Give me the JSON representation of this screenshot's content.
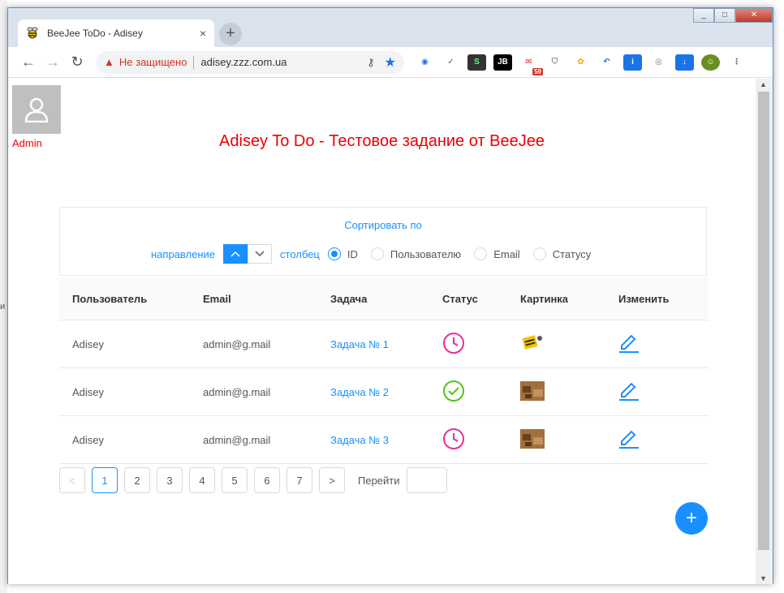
{
  "browser": {
    "tab_title": "BeeJee ToDo - Adisey",
    "tab_close": "×",
    "new_tab": "+",
    "insecure_label": "Не защищено",
    "url": "adisey.zzz.com.ua",
    "ext_badge": "59"
  },
  "page": {
    "user_label": "Admin",
    "title": "Adisey To Do - Тестовое задание от BeeJee"
  },
  "sort": {
    "title": "Сортировать по",
    "direction_label": "направление",
    "column_label": "столбец",
    "options": [
      "ID",
      "Пользователю",
      "Email",
      "Статусу"
    ],
    "selected": "ID"
  },
  "table": {
    "headers": [
      "Пользователь",
      "Email",
      "Задача",
      "Статус",
      "Картинка",
      "Изменить"
    ],
    "rows": [
      {
        "user": "Adisey",
        "email": "admin@g.mail",
        "task": "Задача № 1",
        "status": "pending"
      },
      {
        "user": "Adisey",
        "email": "admin@g.mail",
        "task": "Задача № 2",
        "status": "done"
      },
      {
        "user": "Adisey",
        "email": "admin@g.mail",
        "task": "Задача № 3",
        "status": "pending"
      }
    ]
  },
  "pagination": {
    "prev": "<",
    "pages": [
      "1",
      "2",
      "3",
      "4",
      "5",
      "6",
      "7"
    ],
    "current": "1",
    "next": ">",
    "goto_label": "Перейти"
  },
  "colors": {
    "accent": "#1890ff",
    "title_red": "#e00000",
    "pending": "#eb2f96",
    "done": "#52c41a"
  }
}
